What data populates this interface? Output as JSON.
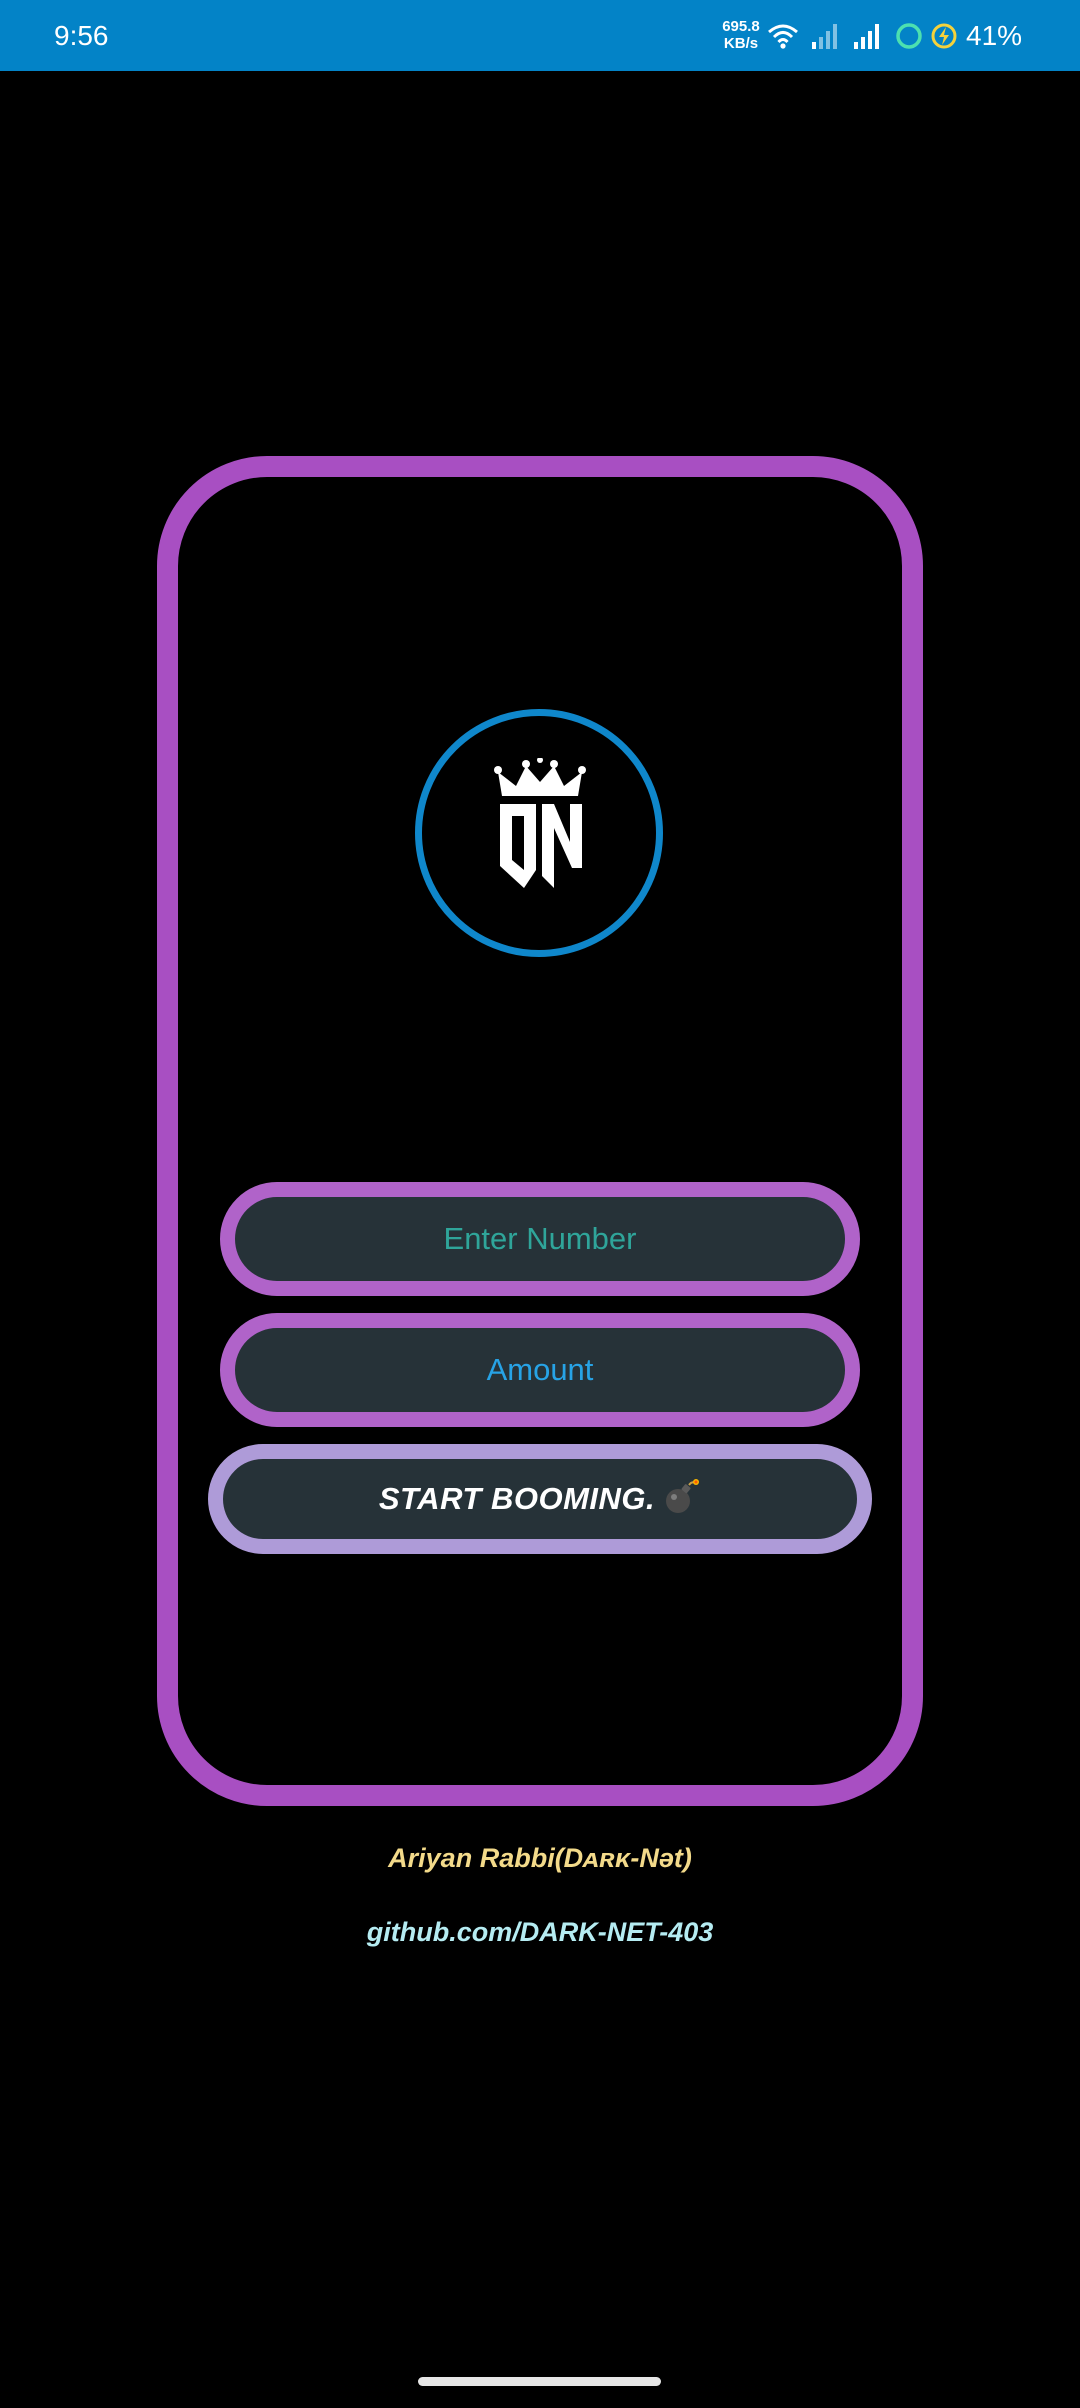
{
  "status_bar": {
    "time": "9:56",
    "net_speed_value": "695.8",
    "net_speed_unit": "KB/s",
    "battery": "41%",
    "background_color": "#0383c7",
    "icons": [
      "wifi-icon",
      "signal-icon",
      "signal-icon",
      "sync-ring-icon",
      "battery-charging-icon"
    ]
  },
  "logo": {
    "text": "DN",
    "icon": "crown-icon",
    "ring_color": "#0f87cb"
  },
  "form": {
    "number_placeholder": "Enter Number",
    "amount_placeholder": "Amount",
    "start_button_label": "START BOOMING.",
    "start_button_icon": "bomb-icon"
  },
  "credits": {
    "author": "Ariyan Rabbi(Dᴀʀᴋ-Nət)",
    "link": "github.com/DARK-NET-403"
  },
  "colors": {
    "frame": "#a84fc2",
    "input_border": "#b063c9",
    "button_border": "#ae9bd8",
    "field_fill": "#263238",
    "number_text": "#2fa59a",
    "amount_text": "#27a3e6",
    "author_text": "#f3da8a",
    "link_text": "#b5ecf2"
  }
}
